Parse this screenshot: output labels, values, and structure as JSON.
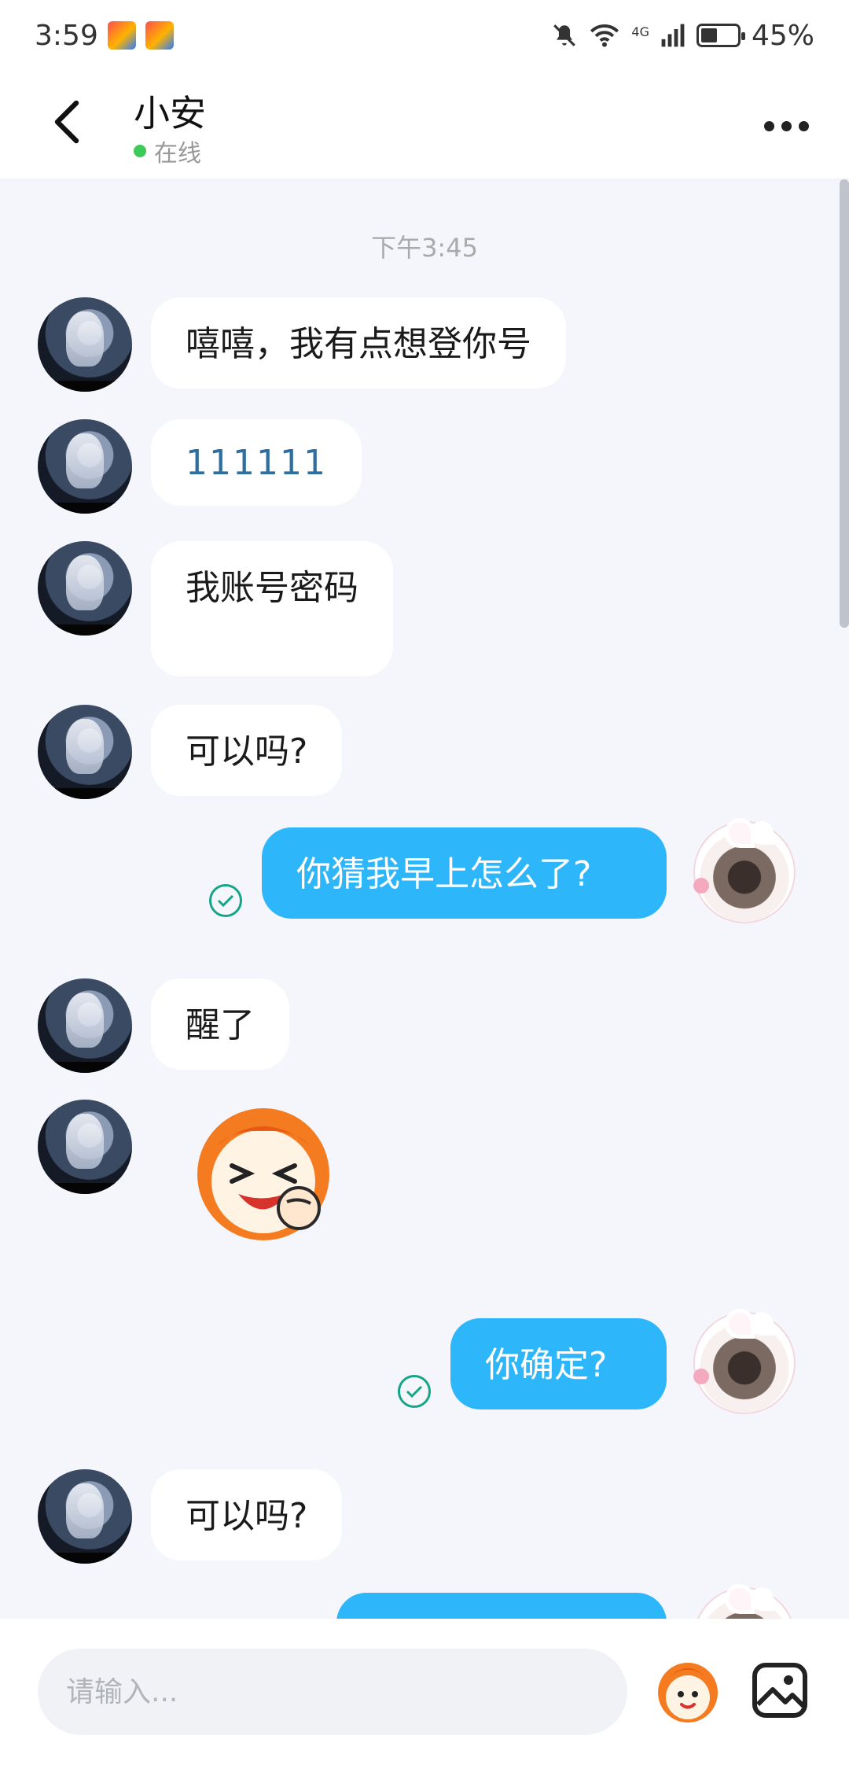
{
  "status_bar": {
    "time": "3:59",
    "battery": "45%",
    "network": "4G",
    "icons": [
      "app-badge-icon",
      "app-badge-icon",
      "mute-icon",
      "wifi-icon",
      "signal-icon",
      "battery-icon"
    ]
  },
  "header": {
    "title": "小安",
    "status": "在线",
    "status_color": "#3ccb5a"
  },
  "chat": {
    "timestamp": "下午3:45",
    "messages": [
      {
        "from": "them",
        "text": "嘻嘻，我有点想登你号"
      },
      {
        "from": "them",
        "text": "111111"
      },
      {
        "from": "them",
        "text": "我账号密码"
      },
      {
        "from": "them",
        "text": "可以吗?"
      },
      {
        "from": "me",
        "text": "你猜我早上怎么了?"
      },
      {
        "from": "them",
        "text": "醒了"
      },
      {
        "from": "them",
        "type": "sticker",
        "icon": "laughing-sticker-icon"
      },
      {
        "from": "me",
        "text": "你确定?"
      },
      {
        "from": "them",
        "text": "可以吗?"
      },
      {
        "from": "me",
        "text": ""
      }
    ]
  },
  "input_bar": {
    "placeholder": "请输入...",
    "value": "",
    "icons": [
      "sticker-icon",
      "image-icon"
    ]
  },
  "colors": {
    "background": "#f4f6fb",
    "incoming_bubble": "#ffffff",
    "outgoing_bubble": "#2eb6fb",
    "read_check": "#17a587"
  }
}
